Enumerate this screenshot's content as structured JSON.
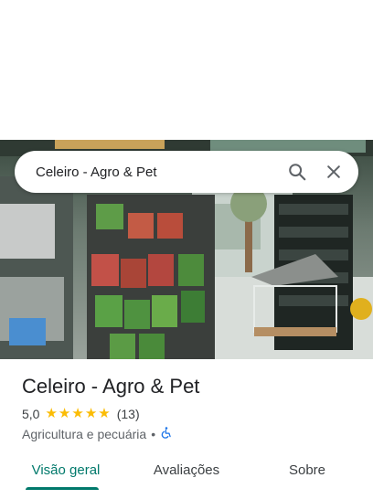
{
  "search": {
    "query": "Celeiro - Agro & Pet"
  },
  "place": {
    "name": "Celeiro - Agro & Pet",
    "rating": "5,0",
    "stars": 5,
    "review_count": "(13)",
    "category": "Agricultura e pecuária",
    "separator": "•"
  },
  "tabs": [
    {
      "label": "Visão geral",
      "active": true
    },
    {
      "label": "Avaliações",
      "active": false
    },
    {
      "label": "Sobre",
      "active": false
    }
  ],
  "colors": {
    "accent": "#00796b",
    "star": "#fbbc04",
    "accessibility": "#1a73e8"
  },
  "icons": {
    "search": "search-icon",
    "close": "close-icon",
    "accessible": "wheelchair-icon",
    "star": "star-icon"
  }
}
